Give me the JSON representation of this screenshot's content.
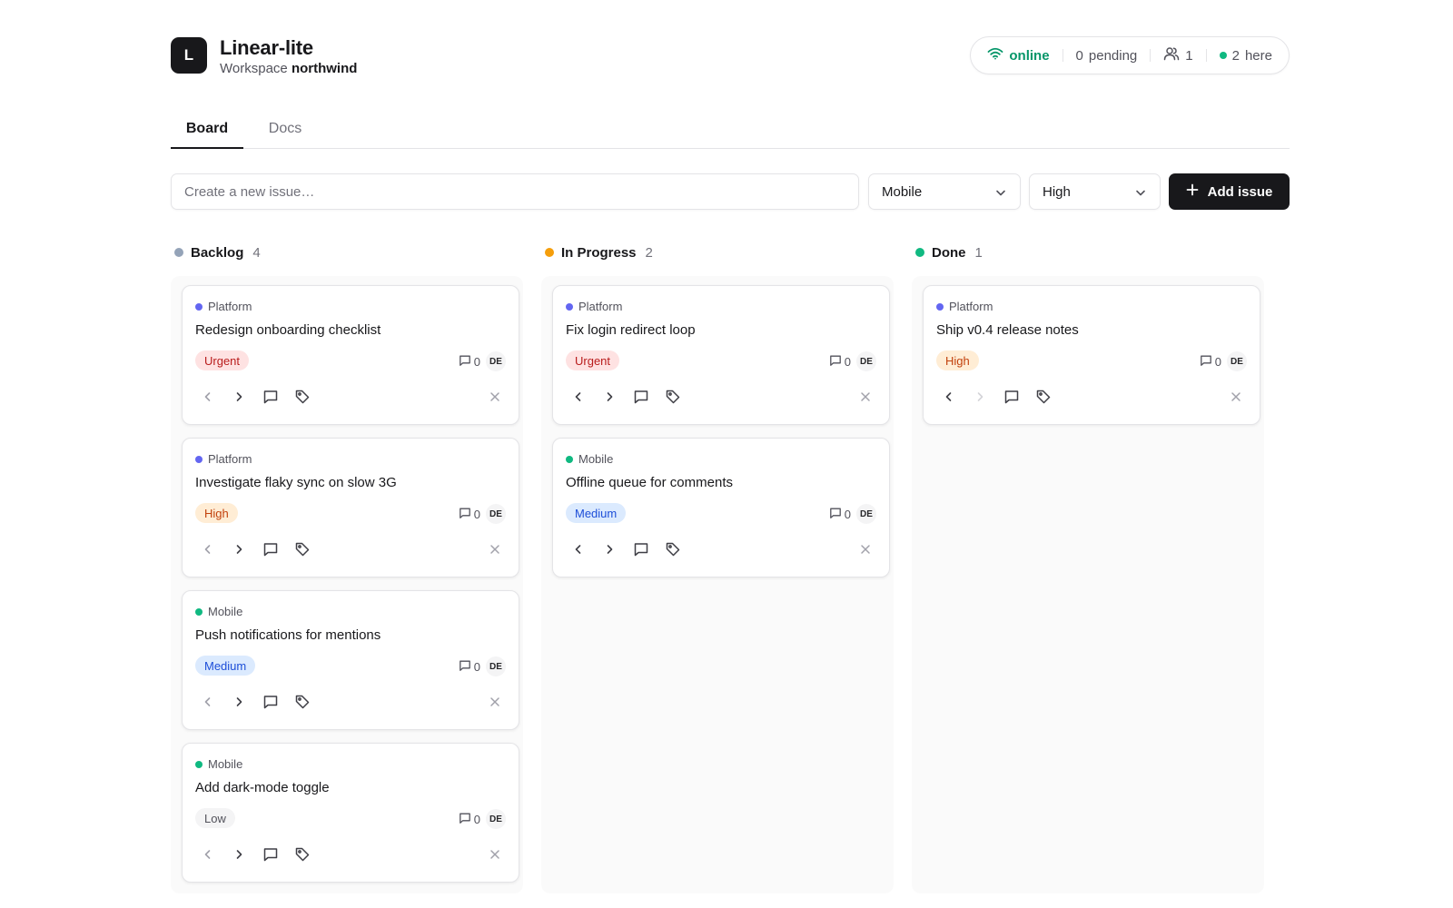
{
  "app": {
    "logo_letter": "L",
    "title": "Linear-lite",
    "workspace_label": "Workspace",
    "workspace_name": "northwind"
  },
  "status": {
    "online_label": "online",
    "pending_count": "0",
    "pending_label": "pending",
    "users_count": "1",
    "here_count": "2",
    "here_label": "here"
  },
  "tabs": [
    {
      "label": "Board",
      "active": true
    },
    {
      "label": "Docs",
      "active": false
    }
  ],
  "create": {
    "placeholder": "Create a new issue…",
    "team_value": "Mobile",
    "priority_value": "High",
    "add_label": "Add issue"
  },
  "colors": {
    "platform": "#6366f1",
    "mobile": "#10b981",
    "backlog": "#94a3b8",
    "in_progress": "#f59e0b",
    "done": "#10b981"
  },
  "columns": [
    {
      "name": "Backlog",
      "count": "4",
      "cards": [
        {
          "team": "Platform",
          "title": "Redesign onboarding checklist",
          "priority": "Urgent",
          "comments": "0",
          "avatar": "DE"
        },
        {
          "team": "Platform",
          "title": "Investigate flaky sync on slow 3G",
          "priority": "High",
          "comments": "0",
          "avatar": "DE"
        },
        {
          "team": "Mobile",
          "title": "Push notifications for mentions",
          "priority": "Medium",
          "comments": "0",
          "avatar": "DE"
        },
        {
          "team": "Mobile",
          "title": "Add dark-mode toggle",
          "priority": "Low",
          "comments": "0",
          "avatar": "DE"
        }
      ]
    },
    {
      "name": "In Progress",
      "count": "2",
      "cards": [
        {
          "team": "Platform",
          "title": "Fix login redirect loop",
          "priority": "Urgent",
          "comments": "0",
          "avatar": "DE"
        },
        {
          "team": "Mobile",
          "title": "Offline queue for comments",
          "priority": "Medium",
          "comments": "0",
          "avatar": "DE"
        }
      ]
    },
    {
      "name": "Done",
      "count": "1",
      "cards": [
        {
          "team": "Platform",
          "title": "Ship v0.4 release notes",
          "priority": "High",
          "comments": "0",
          "avatar": "DE"
        }
      ]
    }
  ]
}
